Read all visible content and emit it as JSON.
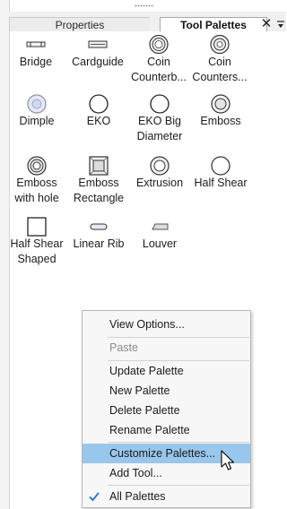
{
  "tabs": [
    {
      "label": "Properties",
      "active": false
    },
    {
      "label": "Tool Palettes",
      "active": true
    }
  ],
  "close_glyph": "✕",
  "tools": [
    {
      "label": "Bridge",
      "icon": "bridge-icon"
    },
    {
      "label": "Cardguide",
      "icon": "cardguide-icon"
    },
    {
      "label": "Coin\nCounterb...",
      "icon": "coin-counterbore-icon"
    },
    {
      "label": "Coin\nCounters...",
      "icon": "coin-countersink-icon"
    },
    {
      "label": "Dimple",
      "icon": "dimple-icon"
    },
    {
      "label": "EKO",
      "icon": "eko-icon"
    },
    {
      "label": "EKO Big\nDiameter",
      "icon": "eko-big-diameter-icon"
    },
    {
      "label": "Emboss",
      "icon": "emboss-icon"
    },
    {
      "label": "Emboss\nwith hole",
      "icon": "emboss-with-hole-icon"
    },
    {
      "label": "Emboss\nRectangle",
      "icon": "emboss-rectangle-icon"
    },
    {
      "label": "Extrusion",
      "icon": "extrusion-icon"
    },
    {
      "label": "Half Shear",
      "icon": "half-shear-icon"
    },
    {
      "label": "Half Shear\nShaped",
      "icon": "half-shear-shaped-icon"
    },
    {
      "label": "Linear Rib",
      "icon": "linear-rib-icon"
    },
    {
      "label": "Louver",
      "icon": "louver-icon"
    }
  ],
  "context_menu": {
    "items": [
      {
        "label": "View Options...",
        "state": "normal"
      },
      {
        "label": "Paste",
        "state": "disabled"
      },
      {
        "label": "Update Palette",
        "state": "normal"
      },
      {
        "label": "New Palette",
        "state": "normal"
      },
      {
        "label": "Delete Palette",
        "state": "normal"
      },
      {
        "label": "Rename Palette",
        "state": "normal"
      },
      {
        "label": "Customize Palettes...",
        "state": "highlighted"
      },
      {
        "label": "Add Tool...",
        "state": "normal"
      },
      {
        "label": "All Palettes",
        "state": "checked"
      }
    ]
  },
  "colors": {
    "highlight": "#99c6ec",
    "check": "#2f7fd0",
    "disabled_text": "#8a8a8a"
  }
}
